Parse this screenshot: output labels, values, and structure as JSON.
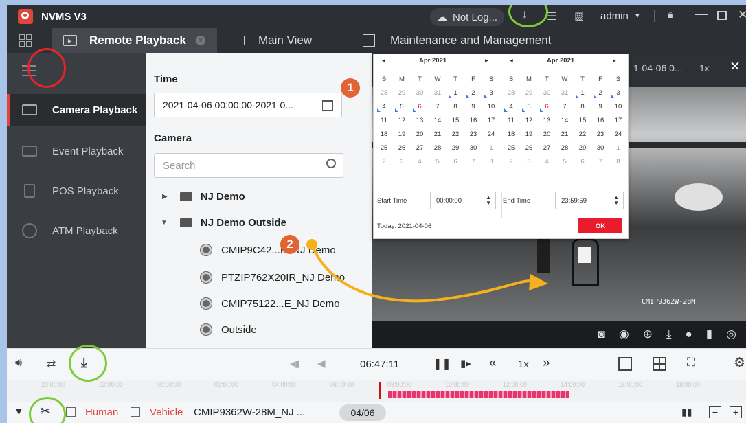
{
  "app": {
    "title": "NVMS V3",
    "cloud_status": "Not Log...",
    "user": "admin"
  },
  "tabs": [
    {
      "label": "Remote Playback"
    },
    {
      "label": "Main View"
    },
    {
      "label": "Maintenance and Management"
    }
  ],
  "sidebar": {
    "items": [
      {
        "label": "Camera Playback",
        "active": true
      },
      {
        "label": "Event Playback"
      },
      {
        "label": "POS Playback"
      },
      {
        "label": "ATM Playback"
      }
    ]
  },
  "panel": {
    "time_label": "Time",
    "time_value": "2021-04-06 00:00:00-2021-0...",
    "camera_label": "Camera",
    "search_placeholder": "Search",
    "tree": [
      {
        "label": "NJ Demo",
        "type": "folder",
        "expanded": false
      },
      {
        "label": "NJ Demo Outside",
        "type": "folder",
        "expanded": true
      },
      {
        "label": "CMIP9C42...E_NJ Demo",
        "type": "camera"
      },
      {
        "label": "PTZIP762X20IR_NJ Demo",
        "type": "camera"
      },
      {
        "label": "CMIP75122...E_NJ Demo",
        "type": "camera"
      },
      {
        "label": "Outside",
        "type": "camera"
      }
    ]
  },
  "calendar": {
    "left": {
      "month": "Apr  2021"
    },
    "right": {
      "month": "Apr  2021"
    },
    "weekdays": [
      "S",
      "M",
      "T",
      "W",
      "T",
      "F",
      "S"
    ],
    "days": [
      [
        "28",
        "29",
        "30",
        "31",
        "1",
        "2",
        "3"
      ],
      [
        "4",
        "5",
        "6",
        "7",
        "8",
        "9",
        "10"
      ],
      [
        "11",
        "12",
        "13",
        "14",
        "15",
        "16",
        "17"
      ],
      [
        "18",
        "19",
        "20",
        "21",
        "22",
        "23",
        "24"
      ],
      [
        "25",
        "26",
        "27",
        "28",
        "29",
        "30",
        "1"
      ],
      [
        "2",
        "3",
        "4",
        "5",
        "6",
        "7",
        "8"
      ]
    ],
    "start_time_label": "Start Time",
    "start_time": "00:00:00",
    "end_time_label": "End Time",
    "end_time": "23:59:59",
    "today_text": "Today: 2021-04-06",
    "ok_label": "OK"
  },
  "video": {
    "header_text": "1-04-06 0...",
    "speed": "1x",
    "overlay_label": "CMIP9362W-28M"
  },
  "playbar": {
    "time": "06:47:11",
    "speed": "1x"
  },
  "timeline": {
    "ticks": [
      "20:00:00",
      "22:00:00",
      "00:00:00",
      "02:00:00",
      "04:00:00",
      "06:00:00",
      "08:00:00",
      "10:00:00",
      "12:00:00",
      "14:00:00",
      "16:00:00",
      "18:00:00"
    ]
  },
  "bottombar": {
    "human_label": "Human",
    "vehicle_label": "Vehicle",
    "camera_name": "CMIP9362W-28M_NJ ...",
    "date_badge": "04/06"
  },
  "annotations": {
    "badge1": "1",
    "badge2": "2"
  },
  "colors": {
    "accent": "#e0443c",
    "highlight_green": "#7ecb3a",
    "recording": "#e8336b",
    "ok_button": "#e81c2c"
  }
}
